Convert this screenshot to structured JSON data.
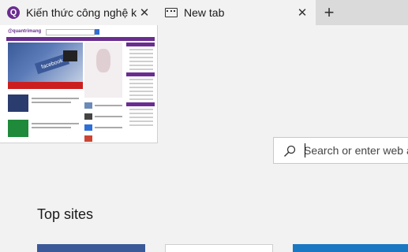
{
  "tabs": [
    {
      "title": "Kiến thức công nghệ kh",
      "favicon": "quantrimang-icon",
      "active": true,
      "close_label": "✕"
    },
    {
      "title": "New tab",
      "favicon": "new-tab-icon",
      "active": false,
      "close_label": "✕"
    }
  ],
  "new_tab_button": "+",
  "preview": {
    "logo_text": "@quantrimang",
    "hero_badge": "facebook"
  },
  "search": {
    "placeholder": "Search or enter web address",
    "icon": "search-icon"
  },
  "top_sites": {
    "title": "Top sites",
    "tile_colors": [
      "#3b5998",
      "#ffffff",
      "#1a78c2"
    ]
  },
  "colors": {
    "brand_purple": "#6a2d8f",
    "tab_strip": "#dadada",
    "page_background": "#f2f2f2"
  }
}
